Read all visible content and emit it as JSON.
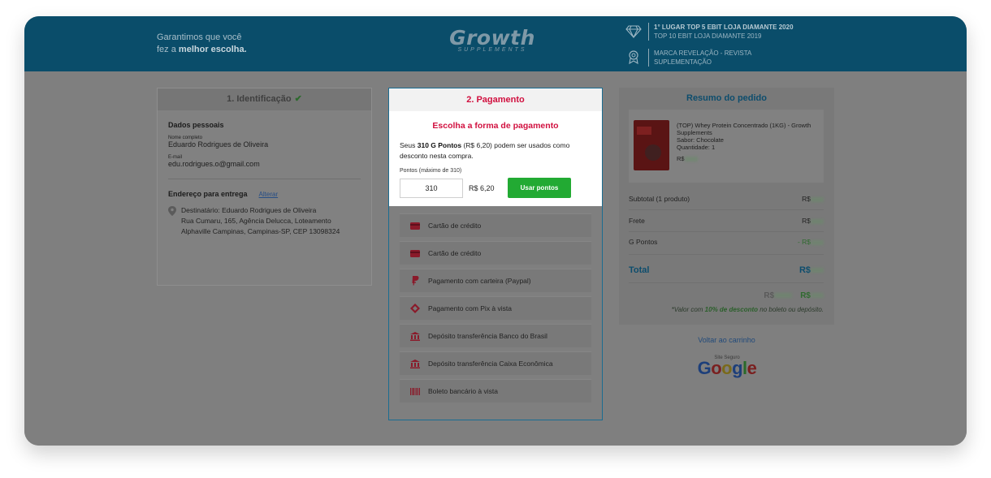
{
  "header": {
    "tagline_line1": "Garantimos que você",
    "tagline_prefix": "fez a",
    "tagline_bold": "melhor escolha.",
    "logo_main": "Growth",
    "logo_sub": "SUPPLEMENTS",
    "award1_line1": "1° LUGAR TOP 5 EBIT LOJA DIAMANTE 2020",
    "award1_line2": "TOP 10 EBIT LOJA DIAMANTE 2019",
    "award2_line1": "MARCA REVELAÇÃO - REVISTA",
    "award2_line2": "SUPLEMENTAÇÃO"
  },
  "identification": {
    "title": "1. Identificação",
    "personal_title": "Dados pessoais",
    "name_label": "Nome completo",
    "name_value": "Eduardo Rodrigues de Oliveira",
    "email_label": "E-mail",
    "email_value": "edu.rodrigues.o@gmail.com",
    "address_title": "Endereço para entrega",
    "alter_link": "Alterar",
    "address_line1": "Destinatário: Eduardo Rodrigues de Oliveira",
    "address_line2": "Rua Cumaru, 165, Agência Delucca, Loteamento",
    "address_line3": "Alphaville Campinas, Campinas-SP, CEP 13098324"
  },
  "payment": {
    "title": "2. Pagamento",
    "choose_title": "Escolha a forma de pagamento",
    "points_prefix": "Seus",
    "points_bold": "310 G Pontos",
    "points_suffix": "(R$ 6,20) podem ser usados como",
    "points_line2": "desconto nesta compra.",
    "points_label": "Pontos (máximo de 310)",
    "points_input_value": "310",
    "points_money": "R$ 6,20",
    "use_points_button": "Usar pontos",
    "methods": [
      {
        "label": "Cartão de crédito",
        "icon": "credit-card-icon"
      },
      {
        "label": "Cartão de crédito",
        "icon": "credit-card-icon"
      },
      {
        "label": "Pagamento com carteira (Paypal)",
        "icon": "paypal-icon"
      },
      {
        "label": "Pagamento com Pix à vista",
        "icon": "pix-icon"
      },
      {
        "label": "Depósito transferência Banco do Brasil",
        "icon": "bank-icon"
      },
      {
        "label": "Depósito transferência Caixa Econômica",
        "icon": "bank-icon"
      },
      {
        "label": "Boleto bancário à vista",
        "icon": "barcode-icon"
      }
    ],
    "accent_color": "#d1103f"
  },
  "summary": {
    "title": "Resumo do pedido",
    "product_name": "(TOP) Whey Protein Concentrado (1KG) - Growth Supplements",
    "product_flavor": "Sabor: Chocolate",
    "product_qty": "Quantidade: 1",
    "product_price_prefix": "R$",
    "subtotal_label": "Subtotal (1 produto)",
    "subtotal_prefix": "R$",
    "shipping_label": "Frete",
    "shipping_prefix": "R$",
    "points_label": "G Pontos",
    "points_prefix": "- R$",
    "total_label": "Total",
    "total_prefix": "R$",
    "old_price_prefix": "R$",
    "new_price_prefix": "R$",
    "note_prefix": "*Valor com",
    "note_bold": "10% de desconto",
    "note_suffix": "no boleto ou depósito.",
    "back_link": "Voltar ao carrinho",
    "google_small": "Site Seguro",
    "google_word": "Google"
  }
}
